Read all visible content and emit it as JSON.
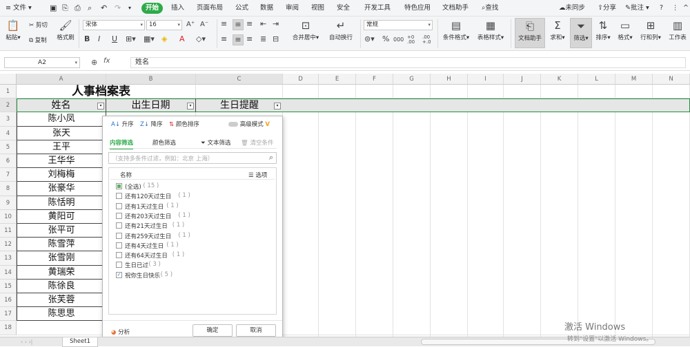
{
  "menu": {
    "file": "文件",
    "tabs": [
      "开始",
      "插入",
      "页面布局",
      "公式",
      "数据",
      "审阅",
      "视图",
      "安全",
      "开发工具",
      "特色应用",
      "文档助手"
    ],
    "search": "查找",
    "sync": "未同步",
    "share": "分享",
    "comment": "批注"
  },
  "ribbon": {
    "paste": "粘贴",
    "cut": "剪切",
    "copy": "复制",
    "format_painter": "格式刷",
    "font_name": "宋体",
    "font_size": "16",
    "bold": "B",
    "italic": "I",
    "underline": "U",
    "merge_center": "合并居中",
    "wrap_text": "自动换行",
    "number_format": "常规",
    "percent": "%",
    "thousands": "000",
    "inc_decimal": "+0 .00",
    "dec_decimal": ".00 +.0",
    "conditional_format": "条件格式",
    "table_style": "表格样式",
    "doc_assistant": "文档助手",
    "sum": "求和",
    "filter": "筛选",
    "sort": "排序",
    "format": "格式",
    "row_col": "行和列",
    "worksheet": "工作表"
  },
  "formula_bar": {
    "name_box": "A2",
    "fx": "fx",
    "value": "姓名"
  },
  "columns": [
    "A",
    "B",
    "C",
    "D",
    "E",
    "F",
    "G",
    "H",
    "I",
    "J",
    "K",
    "L",
    "M",
    "N"
  ],
  "rows": [
    "1",
    "2",
    "3",
    "4",
    "5",
    "6",
    "7",
    "8",
    "9",
    "10",
    "11",
    "12",
    "13",
    "14",
    "15",
    "16",
    "17",
    "18"
  ],
  "sheet": {
    "title": "人事档案表",
    "headers": [
      "姓名",
      "出生日期",
      "生日提醒"
    ],
    "names": [
      "陈小凤",
      "张天",
      "王平",
      "王华华",
      "刘梅梅",
      "张豪华",
      "陈恬明",
      "黄阳可",
      "张平可",
      "陈雪萍",
      "张雪刚",
      "黄瑞荣",
      "陈徐良",
      "张芙蓉",
      "陈思思"
    ]
  },
  "filter_panel": {
    "asc": "升序",
    "desc": "降序",
    "color_sort": "颜色排序",
    "advanced": "高级模式",
    "tab_content": "内容筛选",
    "tab_color": "颜色筛选",
    "text_filter": "文本筛选",
    "clear": "清空条件",
    "search_placeholder": "（支持多条件过滤，例如：北京  上海）",
    "col_name": "名称",
    "options": "选项",
    "items": [
      {
        "label": "(全选)",
        "count": "( 15 )",
        "state": "partial"
      },
      {
        "label": "还有120天过生日",
        "count": "( 1 )",
        "state": "unchecked"
      },
      {
        "label": "还有1天过生日",
        "count": "( 1 )",
        "state": "unchecked"
      },
      {
        "label": "还有203天过生日",
        "count": "( 1 )",
        "state": "unchecked"
      },
      {
        "label": "还有21天过生日",
        "count": "( 1 )",
        "state": "unchecked"
      },
      {
        "label": "还有259天过生日",
        "count": "( 1 )",
        "state": "unchecked"
      },
      {
        "label": "还有4天过生日",
        "count": "( 1 )",
        "state": "unchecked"
      },
      {
        "label": "还有64天过生日",
        "count": "( 1 )",
        "state": "unchecked"
      },
      {
        "label": "生日已过",
        "count": "( 3 )",
        "state": "unchecked"
      },
      {
        "label": "祝你生日快乐",
        "count": "( 5 )",
        "state": "checked"
      }
    ],
    "analysis": "分析",
    "ok": "确定",
    "cancel": "取消"
  },
  "sheet_tab": "Sheet1",
  "watermark": {
    "line1": "激活 Windows",
    "line2": "转到\"设置\"以激活 Windows。"
  },
  "colors": {
    "accent": "#2eaa4a",
    "selection_border": "#1f8d3c",
    "checkbox": "#2a6fcf"
  }
}
